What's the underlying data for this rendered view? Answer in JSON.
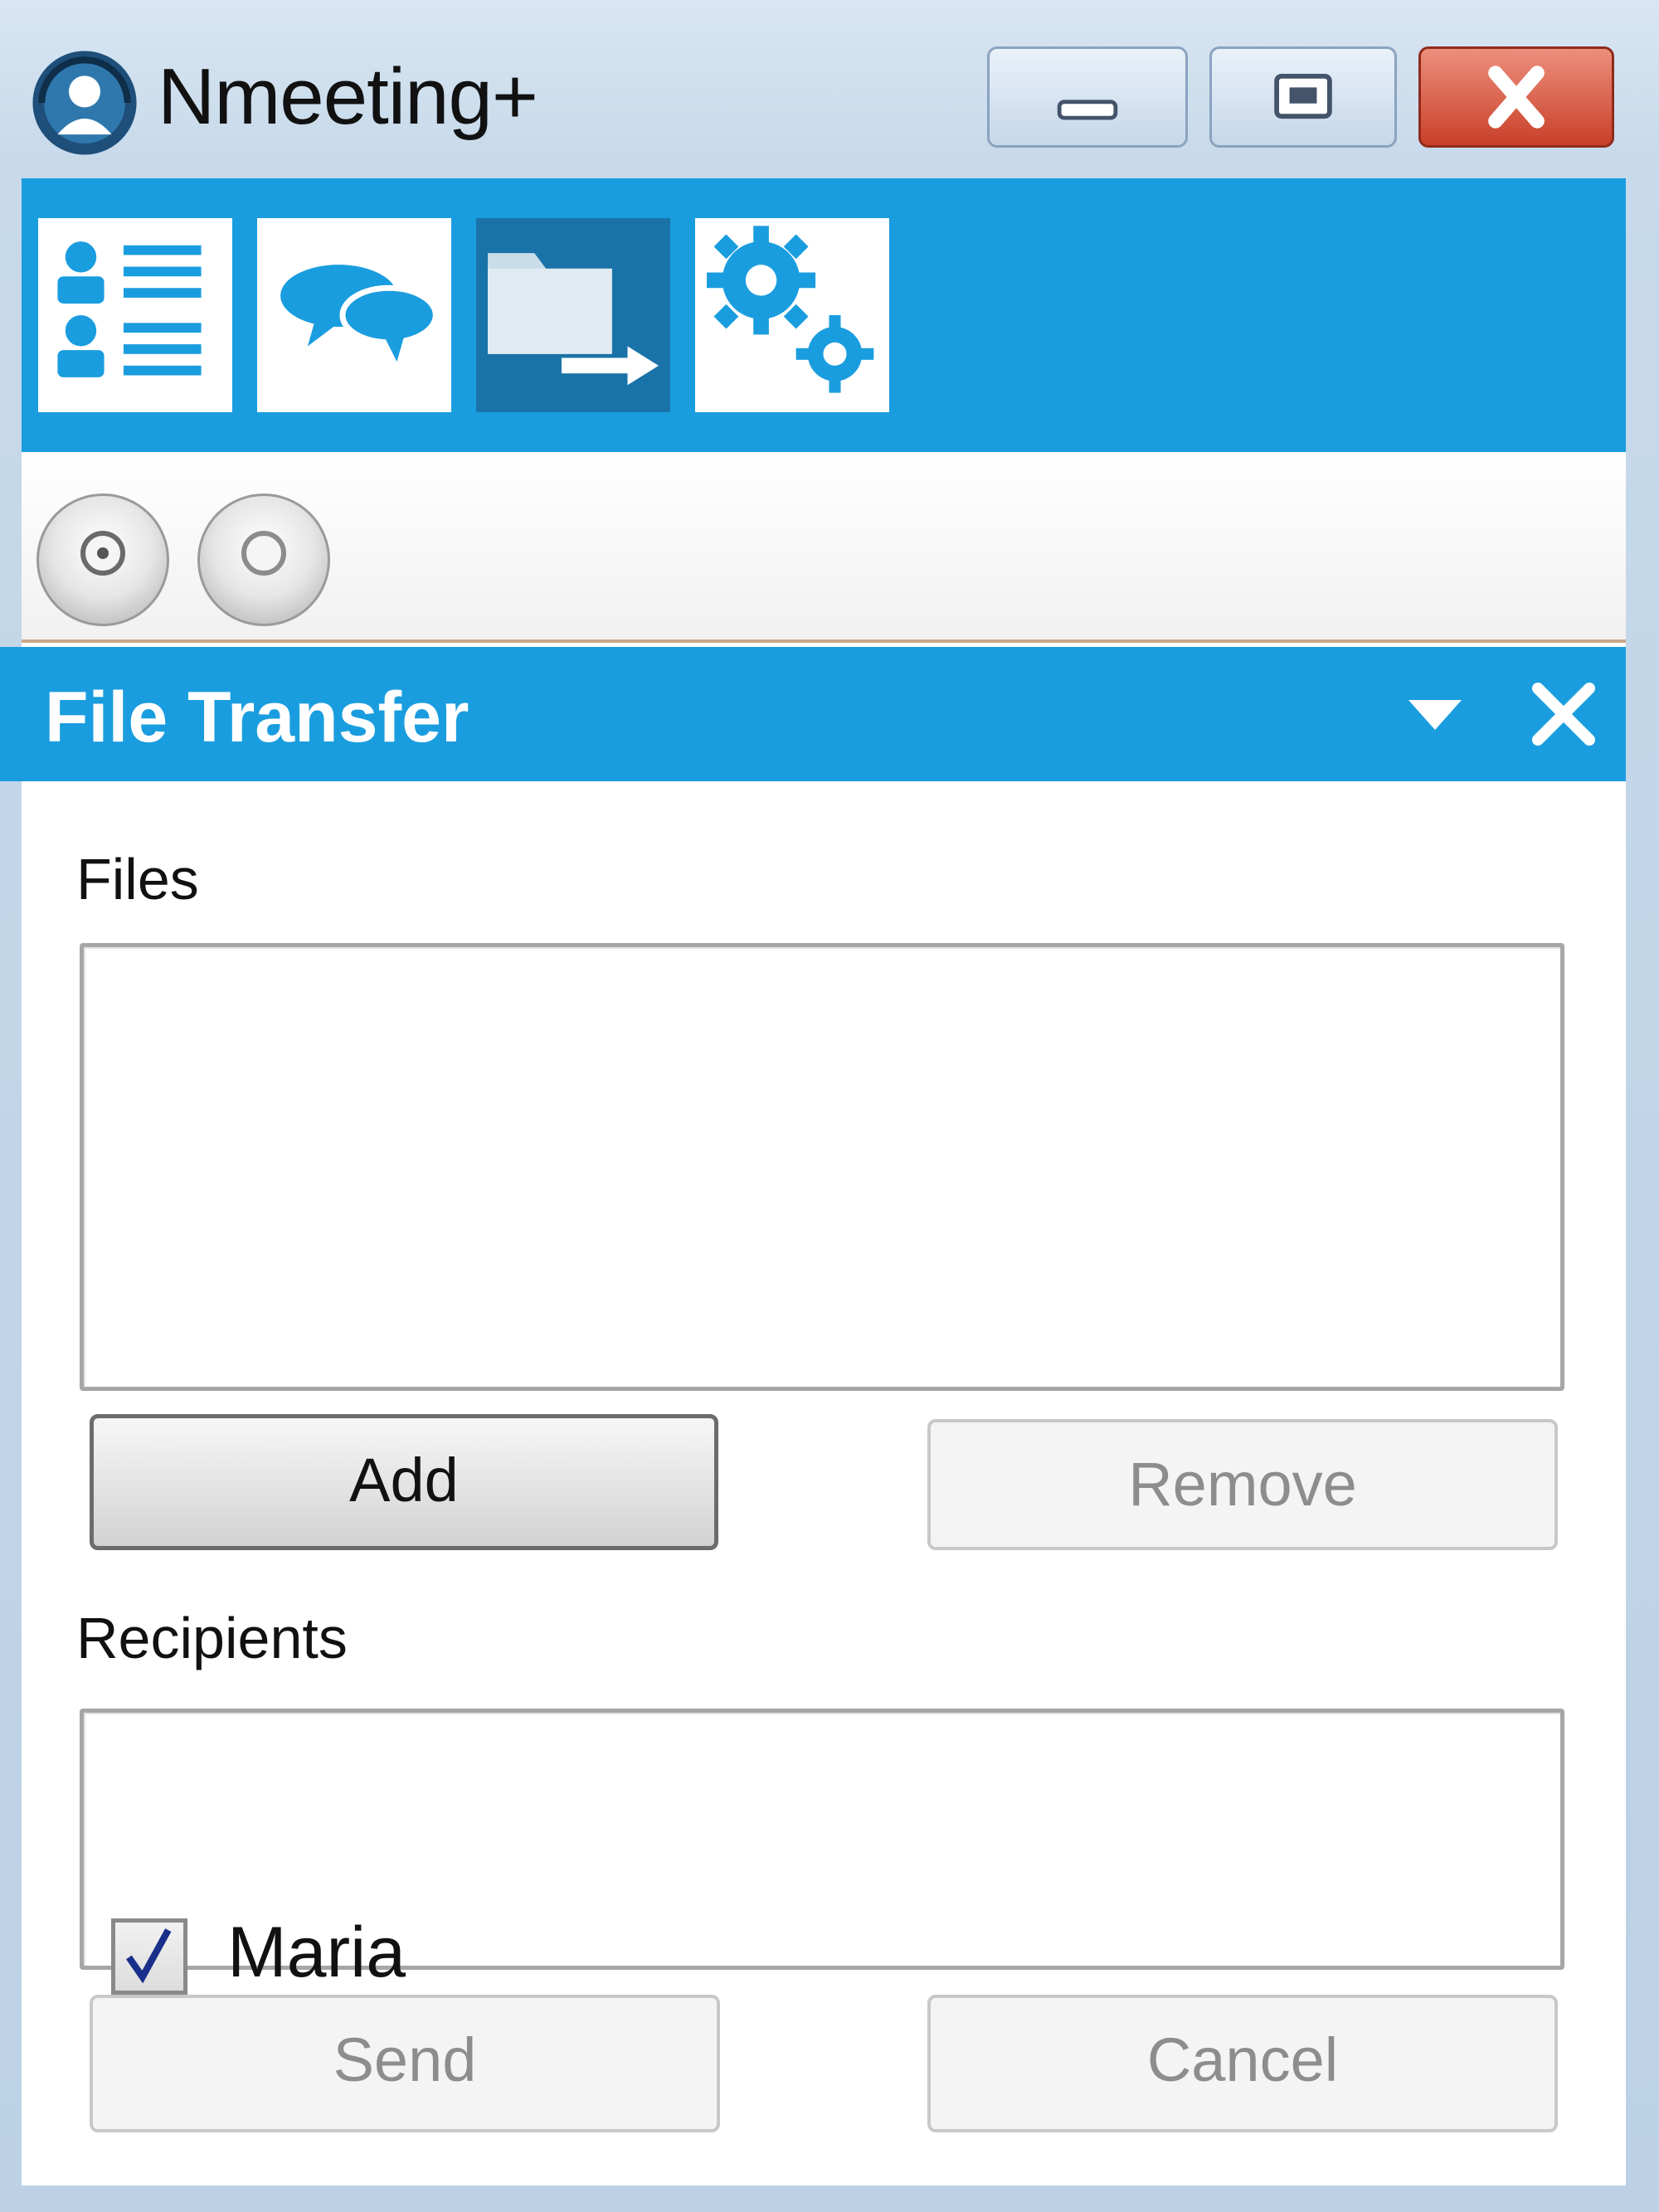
{
  "window": {
    "title": "Nmeeting+",
    "controls": {
      "minimize": "minimize-icon",
      "maximize": "maximize-icon",
      "close": "close-icon"
    }
  },
  "toolbar": {
    "tools": [
      {
        "icon": "participants-list-icon",
        "active": false
      },
      {
        "icon": "chat-bubbles-icon",
        "active": false
      },
      {
        "icon": "file-transfer-icon",
        "active": true
      },
      {
        "icon": "settings-gears-icon",
        "active": false
      }
    ]
  },
  "subbar": {
    "buttons": [
      "radio-button-selected",
      "radio-button"
    ]
  },
  "panel": {
    "title": "File Transfer",
    "files_label": "Files",
    "add_label": "Add",
    "remove_label": "Remove",
    "recipients_label": "Recipients",
    "recipients": [
      {
        "name": "Maria",
        "checked": true
      }
    ],
    "send_label": "Send",
    "cancel_label": "Cancel"
  },
  "colors": {
    "accent": "#1a9ddf",
    "active_tool": "#1a73a8",
    "close_button": "#c9402a"
  }
}
